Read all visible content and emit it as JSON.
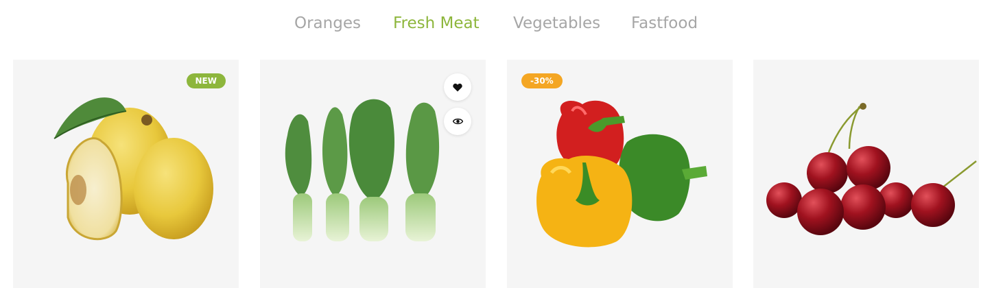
{
  "tabs": [
    {
      "label": "Oranges",
      "active": false
    },
    {
      "label": "Fresh Meat",
      "active": true
    },
    {
      "label": "Vegetables",
      "active": false
    },
    {
      "label": "Fastfood",
      "active": false
    }
  ],
  "colors": {
    "accent": "#8db63c",
    "sale": "#f4a623",
    "tab_inactive": "#a6a6a6",
    "card_bg": "#f5f5f5"
  },
  "products": [
    {
      "image": "quince-image",
      "badge": "NEW"
    },
    {
      "image": "bok-choy-image",
      "actions": [
        "heart-icon",
        "eye-icon"
      ]
    },
    {
      "image": "bell-peppers-image",
      "badge": "-30%"
    },
    {
      "image": "cherries-image"
    }
  ]
}
